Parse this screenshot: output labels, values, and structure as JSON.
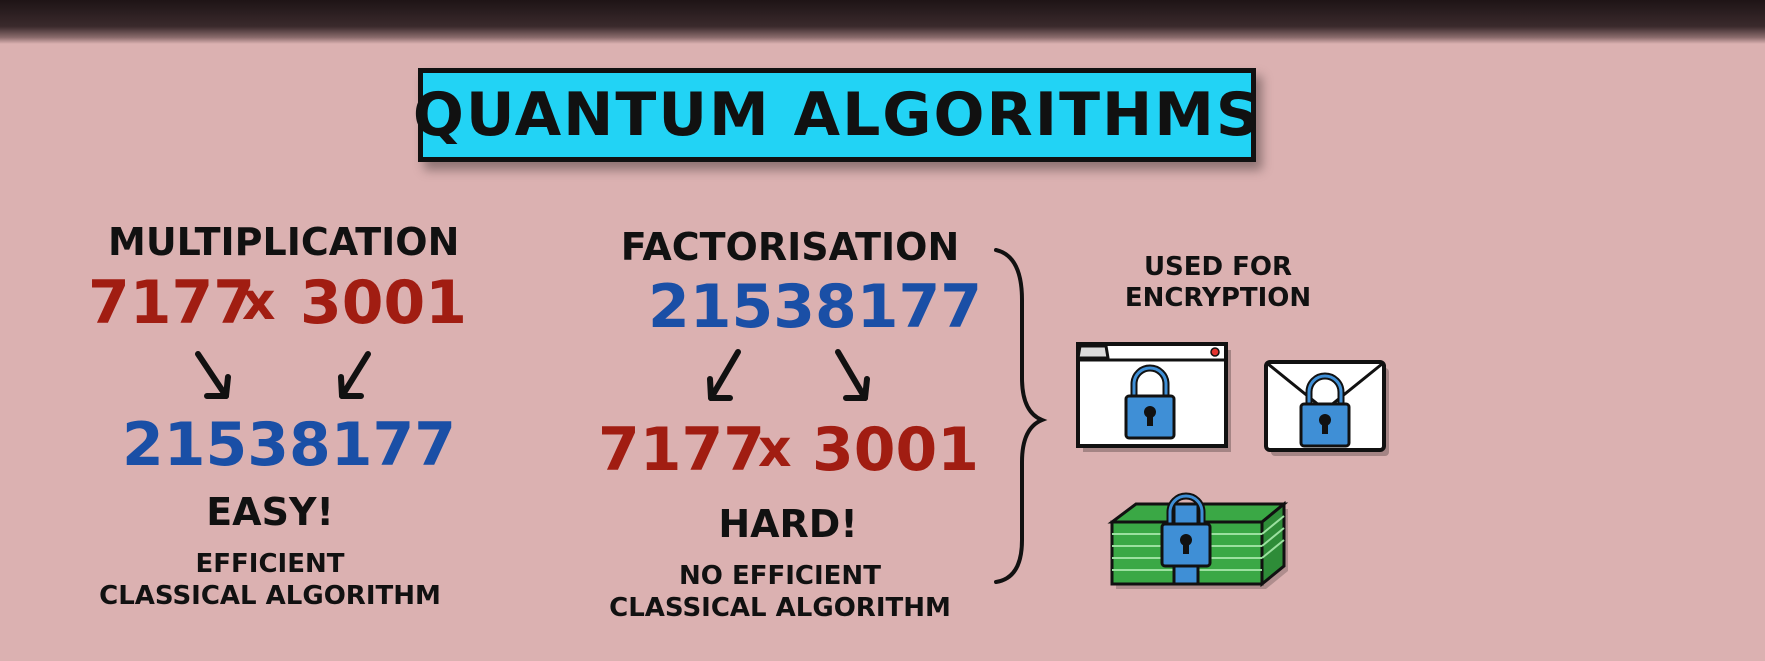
{
  "title": "QUANTUM ALGORITHMS",
  "multiplication": {
    "heading": "MULTIPLICATION",
    "factor_a": "7177",
    "times": "x",
    "factor_b": "3001",
    "product": "21538177",
    "verdict": "EASY!",
    "note_line1": "EFFICIENT",
    "note_line2": "CLASSICAL ALGORITHM"
  },
  "factorisation": {
    "heading": "FACTORISATION",
    "product": "21538177",
    "factor_a": "7177",
    "times": "x",
    "factor_b": "3001",
    "verdict": "HARD!",
    "note_line1": "NO EFFICIENT",
    "note_line2": "CLASSICAL ALGORITHM"
  },
  "encryption": {
    "label_line1": "USED FOR",
    "label_line2": "ENCRYPTION",
    "icons": [
      "browser-lock-icon",
      "envelope-lock-icon",
      "money-lock-icon"
    ]
  },
  "colors": {
    "background": "#dbb1b1",
    "title_box": "#22d3f5",
    "red_numbers": "#a11d12",
    "blue_numbers": "#1a4fa6",
    "lock": "#3f8fd6",
    "money": "#3aa845"
  }
}
